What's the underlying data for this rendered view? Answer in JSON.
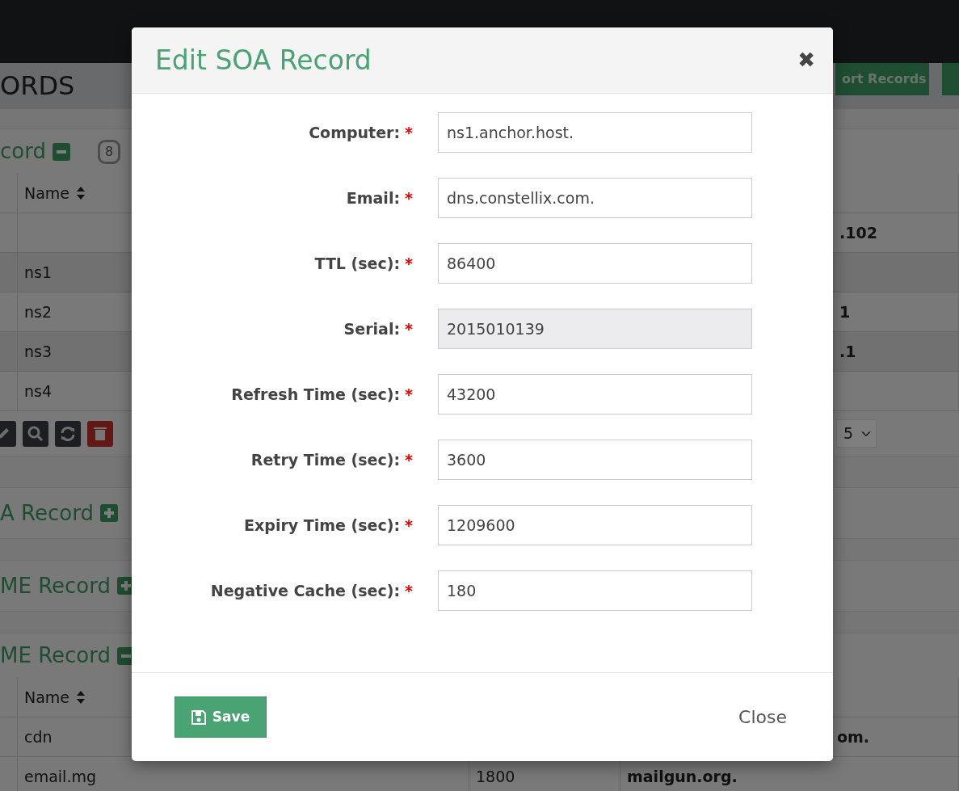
{
  "page": {
    "heading": "ORDS",
    "header_button": {
      "label": "ort Records"
    },
    "sections": [
      {
        "title": "cord",
        "expanded": true,
        "count": "8",
        "table": {
          "columns": [
            "Name"
          ],
          "rows": [
            {
              "value": ".102"
            },
            {
              "name": "ns1"
            },
            {
              "name": "ns2",
              "value": "1"
            },
            {
              "name": "ns3",
              "value": ".1"
            },
            {
              "name": "ns4"
            }
          ]
        },
        "page_size": "5"
      },
      {
        "title": "A Record",
        "expanded": false
      },
      {
        "title": "ME Record",
        "expanded": false
      },
      {
        "title": "ME Record",
        "expanded": true,
        "table": {
          "columns": [
            "Name"
          ],
          "rows": [
            {
              "name": "cdn",
              "value": "om.",
              "cut": true
            },
            {
              "name": "email.mg",
              "ttl": "1800",
              "value": "mailgun.org."
            }
          ]
        }
      }
    ]
  },
  "modal": {
    "title": "Edit SOA Record",
    "close_icon": "✖",
    "fields": [
      {
        "label": "Computer:",
        "required_mark": "*",
        "value": "ns1.anchor.host.",
        "disabled": false
      },
      {
        "label": "Email:",
        "required_mark": "*",
        "value": "dns.constellix.com.",
        "disabled": false
      },
      {
        "label": "TTL (sec):",
        "required_mark": "*",
        "value": "86400",
        "disabled": false
      },
      {
        "label": "Serial:",
        "required_mark": "*",
        "value": "2015010139",
        "disabled": true
      },
      {
        "label": "Refresh Time (sec):",
        "required_mark": "*",
        "value": "43200",
        "disabled": false
      },
      {
        "label": "Retry Time (sec):",
        "required_mark": "*",
        "value": "3600",
        "disabled": false
      },
      {
        "label": "Expiry Time (sec):",
        "required_mark": "*",
        "value": "1209600",
        "disabled": false
      },
      {
        "label": "Negative Cache (sec):",
        "required_mark": "*",
        "value": "180",
        "disabled": false
      }
    ],
    "save_button": "Save",
    "close_button": "Close"
  }
}
